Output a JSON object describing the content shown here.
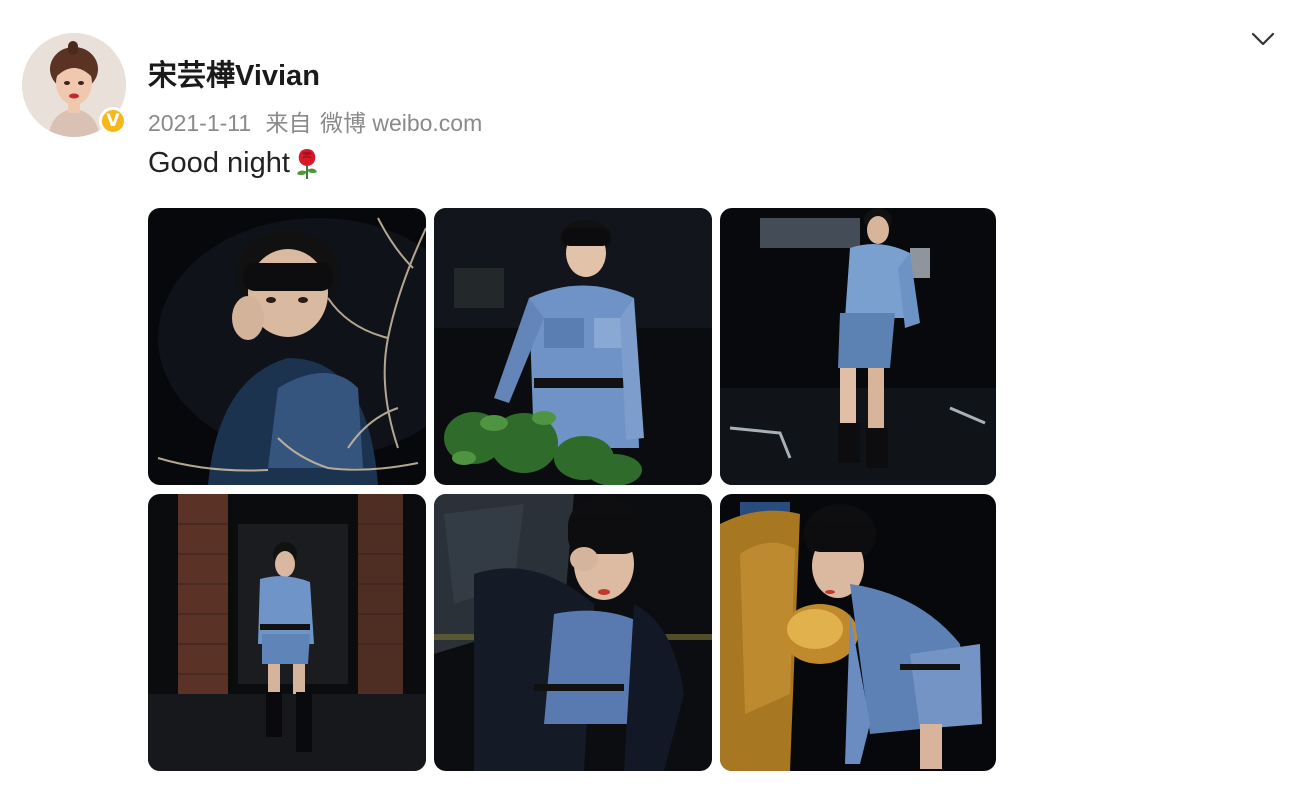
{
  "post": {
    "username": "宋芸樺Vivian",
    "verified_badge": "V",
    "date": "2021-1-11",
    "source_prefix": "来自",
    "source_app": "微博 weibo.com",
    "text": "Good night",
    "emoji": "rose-emoji",
    "menu_icon": "chevron-down-icon"
  },
  "colors": {
    "badge": "#f6b71b",
    "name": "#1a1a1a",
    "meta": "#8a8a8a",
    "photo_bg": "#0b0d12",
    "denim": "#5b7fb4"
  },
  "photos": [
    {
      "index": 1,
      "subject": "close-up with hand at face, bare branches"
    },
    {
      "index": 2,
      "subject": "standing in denim outfit behind plant"
    },
    {
      "index": 3,
      "subject": "walking in denim at night"
    },
    {
      "index": 4,
      "subject": "full body by brick pillars"
    },
    {
      "index": 5,
      "subject": "hand over eye, dark jacket"
    },
    {
      "index": 6,
      "subject": "leaning by gold car"
    }
  ]
}
